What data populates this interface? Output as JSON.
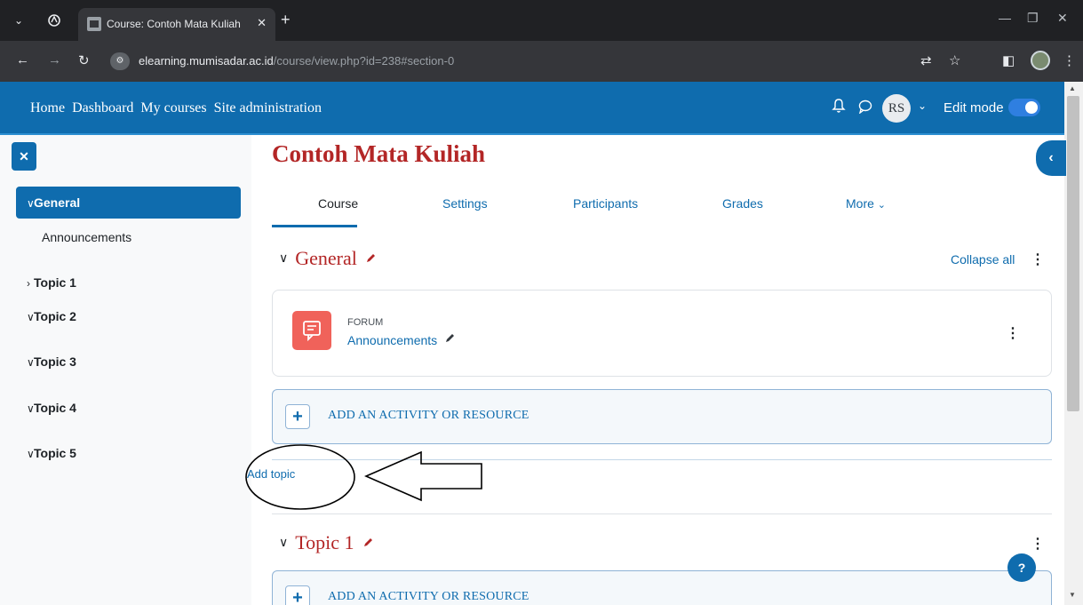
{
  "browser": {
    "tab_title": "Course: Contoh Mata Kuliah",
    "tab_close": "✕",
    "new_tab": "+",
    "url_host": "elearning.mumisadar.ac.id",
    "url_path": "/course/view.php?id=238#section-0"
  },
  "navbar": {
    "links": [
      "Home",
      "Dashboard",
      "My courses",
      "Site administration"
    ],
    "avatar_initials": "RS",
    "edit_mode_label": "Edit mode",
    "edit_mode_on": true
  },
  "course_index": {
    "items": [
      {
        "label": "General",
        "expanded": true,
        "active": true,
        "children": [
          "Announcements"
        ]
      },
      {
        "label": "Topic 1",
        "expanded": false
      },
      {
        "label": "Topic 2",
        "expanded": true
      },
      {
        "label": "Topic 3",
        "expanded": true
      },
      {
        "label": "Topic 4",
        "expanded": true
      },
      {
        "label": "Topic 5",
        "expanded": true
      }
    ]
  },
  "main": {
    "page_title": "Contoh Mata Kuliah",
    "tabs": [
      "Course",
      "Settings",
      "Participants",
      "Grades",
      "More"
    ],
    "active_tab": "Course",
    "collapse_all": "Collapse all",
    "sections": [
      {
        "title": "General"
      },
      {
        "title": "Topic 1"
      }
    ],
    "activity": {
      "type": "FORUM",
      "name": "Announcements"
    },
    "add_activity_label": "ADD AN ACTIVITY OR RESOURCE",
    "add_topic_label": "Add topic",
    "help_label": "?"
  },
  "colors": {
    "brand": "#0f6cae",
    "title_red": "#b32626",
    "forum_icon": "#f0625a"
  },
  "icons": [
    "chevron-down-icon",
    "chevron-right-icon",
    "pencil-icon",
    "kebab-icon",
    "bell-icon",
    "chat-icon",
    "plus-icon",
    "forum-icon",
    "close-icon",
    "chevron-left-icon",
    "help-icon"
  ]
}
